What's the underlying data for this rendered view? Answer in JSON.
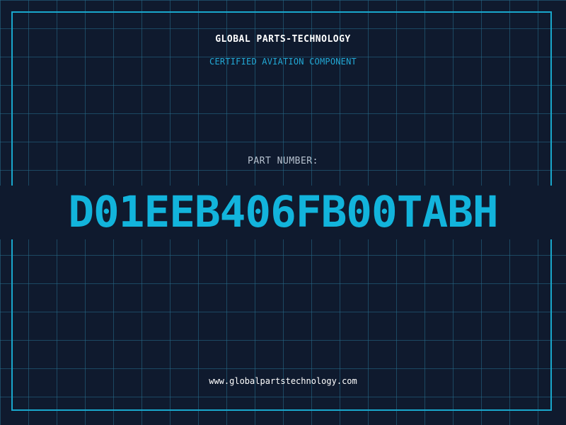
{
  "header": {
    "company": "GLOBAL PARTS-TECHNOLOGY",
    "subtitle": "CERTIFIED AVIATION COMPONENT"
  },
  "part": {
    "label": "PART NUMBER:",
    "number": "D01EEB406FB00TABH"
  },
  "footer": {
    "url": "www.globalpartstechnology.com"
  },
  "colors": {
    "background": "#0f1a2e",
    "grid": "#266e8c",
    "accent": "#19a7cc",
    "part_number": "#12b4dc",
    "label": "#b7c2cf",
    "text": "#ffffff"
  }
}
